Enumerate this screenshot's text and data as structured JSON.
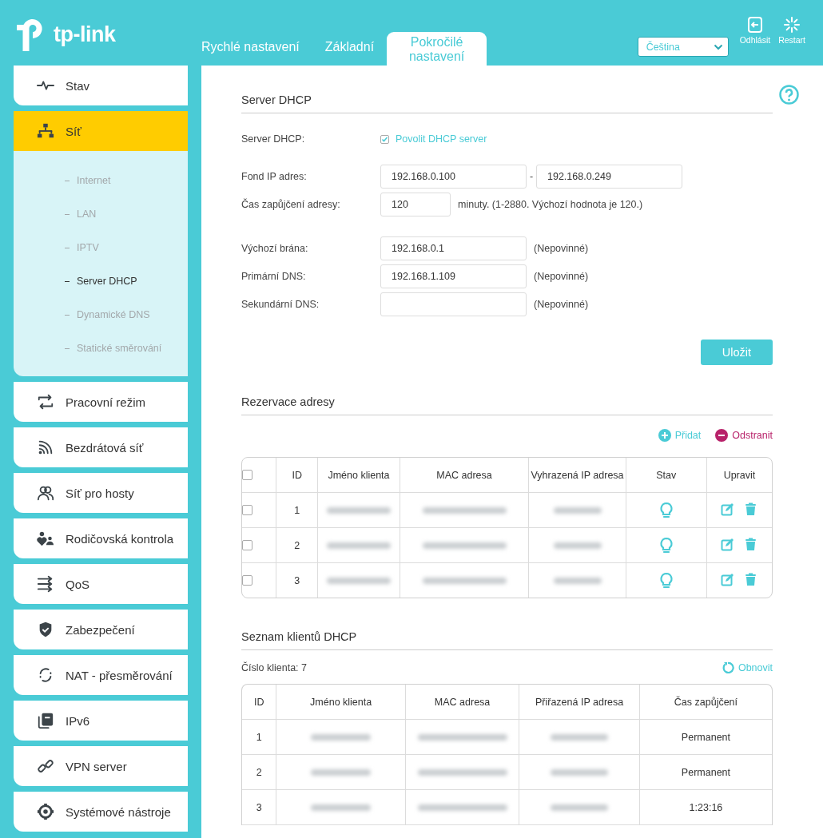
{
  "logo": {
    "text": "tp-link"
  },
  "top_tabs": [
    {
      "label": "Rychlé nastavení",
      "selected": false
    },
    {
      "label": "Základní",
      "selected": false
    },
    {
      "label": "Pokročilé nastavení",
      "selected": true
    }
  ],
  "language": {
    "value": "Čeština"
  },
  "header_buttons": [
    {
      "kind": "logout",
      "label": "Odhlásit"
    },
    {
      "kind": "restart",
      "label": "Restart"
    }
  ],
  "sidebar": {
    "items": [
      {
        "label": "Stav",
        "selected": false
      },
      {
        "label": "Síť",
        "selected": true,
        "expanded": true,
        "children": [
          {
            "label": "Internet",
            "selected": false
          },
          {
            "label": "LAN",
            "selected": false
          },
          {
            "label": "IPTV",
            "selected": false
          },
          {
            "label": "Server DHCP",
            "selected": true
          },
          {
            "label": "Dynamické DNS",
            "selected": false
          },
          {
            "label": "Statické směrování",
            "selected": false
          }
        ]
      },
      {
        "label": "Pracovní režim",
        "selected": false
      },
      {
        "label": "Bezdrátová síť",
        "selected": false
      },
      {
        "label": "Síť pro hosty",
        "selected": false
      },
      {
        "label": "Rodičovská kontrola",
        "selected": false
      },
      {
        "label": "QoS",
        "selected": false
      },
      {
        "label": "Zabezpečení",
        "selected": false
      },
      {
        "label": "NAT - přesměrování",
        "selected": false
      },
      {
        "label": "IPv6",
        "selected": false
      },
      {
        "label": "VPN server",
        "selected": false
      },
      {
        "label": "Systémové nástroje",
        "selected": false
      }
    ]
  },
  "dhcp_server": {
    "title": "Server DHCP",
    "enable": {
      "label": "Server DHCP:",
      "option": "Povolit DHCP server",
      "checked": true
    },
    "field_groups": [
      [
        {
          "kind": "range",
          "label": "Fond IP adres:",
          "value": "192.168.0.100",
          "separator": "-",
          "value2": "192.168.0.249"
        },
        {
          "kind": "short",
          "label": "Čas zapůjčení adresy:",
          "value": "120",
          "note": "minuty. (1-2880. Výchozí hodnota je 120.)"
        }
      ],
      [
        {
          "kind": "normal",
          "label": "Výchozí brána:",
          "value": "192.168.0.1",
          "note": "(Nepovinné)"
        },
        {
          "kind": "normal",
          "label": "Primární DNS:",
          "value": "192.168.1.109",
          "note": "(Nepovinné)"
        },
        {
          "kind": "normal",
          "label": "Sekundární DNS:",
          "note": "(Nepovinné)"
        }
      ]
    ],
    "save_button": "Uložit"
  },
  "reservation": {
    "title": "Rezervace adresy",
    "actions": [
      {
        "kind": "add",
        "label": "Přidat"
      },
      {
        "kind": "remove",
        "label": "Odstranit"
      }
    ],
    "all_checked": false,
    "columns": [
      "ID",
      "Jméno klienta",
      "MAC adresa",
      "Vyhrazená IP adresa",
      "Stav",
      "Upravit"
    ],
    "rows": [
      {
        "checked": false,
        "id": "1",
        "blurred": true,
        "enabled": true
      },
      {
        "checked": false,
        "id": "2",
        "blurred": true,
        "enabled": true
      },
      {
        "checked": false,
        "id": "3",
        "blurred": true,
        "enabled": true
      }
    ]
  },
  "client_list": {
    "title": "Seznam klientů DHCP",
    "count_label": "Číslo klienta:",
    "count": "7",
    "refresh": "Obnovit",
    "columns": [
      "ID",
      "Jméno klienta",
      "MAC adresa",
      "Přiřazená IP adresa",
      "Čas zapůjčení"
    ],
    "rows": [
      {
        "id": "1",
        "blurred": true,
        "lease": "Permanent"
      },
      {
        "id": "2",
        "blurred": true,
        "lease": "Permanent"
      },
      {
        "id": "3",
        "blurred": true,
        "lease": "1:23:16"
      }
    ]
  }
}
